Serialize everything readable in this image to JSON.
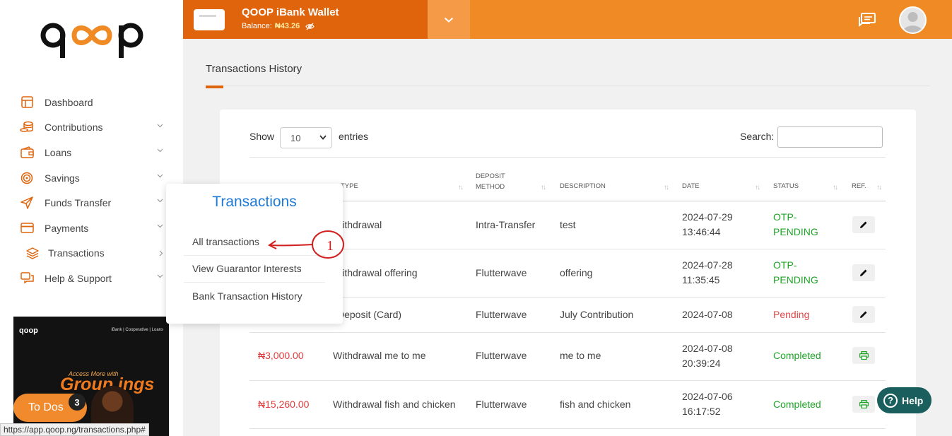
{
  "sidebar": {
    "items": [
      {
        "label": "Dashboard",
        "icon": "layout-icon",
        "has_chevron": false
      },
      {
        "label": "Contributions",
        "icon": "coins-icon",
        "has_chevron": true
      },
      {
        "label": "Loans",
        "icon": "wallet-icon",
        "has_chevron": true
      },
      {
        "label": "Savings",
        "icon": "target-icon",
        "has_chevron": true
      },
      {
        "label": "Funds Transfer",
        "icon": "send-icon",
        "has_chevron": true
      },
      {
        "label": "Payments",
        "icon": "credit-card-icon",
        "has_chevron": true
      },
      {
        "label": "Transactions",
        "icon": "layers-icon",
        "has_chevron": true
      },
      {
        "label": "Help & Support",
        "icon": "chat-bubbles-icon",
        "has_chevron": true
      }
    ],
    "promo": {
      "logo": "qoop",
      "tagline": "iBank | Cooperative | Loans",
      "line": "Access More with",
      "headline": "Group ings"
    },
    "todos": {
      "label": "To Dos",
      "count": "3"
    }
  },
  "topbar": {
    "wallet_title": "QOOP iBank Wallet",
    "balance_label": "Balance:",
    "balance_value": "₦43.26"
  },
  "page": {
    "title": "Transactions History"
  },
  "table_controls": {
    "show_label": "Show",
    "page_size": "10",
    "entries_label": "entries",
    "search_label": "Search:"
  },
  "table": {
    "headers": {
      "type": "TYPE",
      "method_1": "DEPOSIT",
      "method_2": "METHOD",
      "description": "DESCRIPTION",
      "date": "DATE",
      "status": "STATUS",
      "ref": "REF."
    },
    "rows": [
      {
        "amount": "",
        "type": "Withdrawal",
        "method": "Intra-Transfer",
        "description": "test",
        "date": "2024-07-29",
        "time": "13:46:44",
        "status_1": "OTP-",
        "status_2": "PENDING",
        "status_kind": "green",
        "ref_icon": "pencil-icon"
      },
      {
        "amount": "",
        "type": "Withdrawal offering",
        "method": "Flutterwave",
        "description": "offering",
        "date": "2024-07-28",
        "time": "11:35:45",
        "status_1": "OTP-",
        "status_2": "PENDING",
        "status_kind": "green",
        "ref_icon": "pencil-icon"
      },
      {
        "amount": "",
        "type": "Deposit (Card)",
        "method": "Flutterwave",
        "description": "July Contribution",
        "date": "2024-07-08",
        "time": "",
        "status_1": "Pending",
        "status_2": "",
        "status_kind": "red",
        "ref_icon": "pencil-icon"
      },
      {
        "amount": "₦3,000.00",
        "type": "Withdrawal me to me",
        "method": "Flutterwave",
        "description": "me to me",
        "date": "2024-07-08",
        "time": "20:39:24",
        "status_1": "Completed",
        "status_2": "",
        "status_kind": "green",
        "ref_icon": "printer-icon"
      },
      {
        "amount": "₦15,260.00",
        "type": "Withdrawal fish and chicken",
        "method": "Flutterwave",
        "description": "fish and chicken",
        "date": "2024-07-06",
        "time": "16:17:52",
        "status_1": "Completed",
        "status_2": "",
        "status_kind": "green",
        "ref_icon": "printer-icon"
      }
    ]
  },
  "popup": {
    "title": "Transactions",
    "items": [
      "All transactions",
      "View Guarantor Interests",
      "Bank Transaction History"
    ],
    "annotation": "1"
  },
  "help": {
    "label": "Help"
  },
  "status_url": "https://app.qoop.ng/transactions.php#",
  "colors": {
    "brand_orange": "#f08a24",
    "brand_dark_orange": "#e0640c",
    "completed_green": "#1ea327",
    "pending_red": "#e04848",
    "amount_red": "#e03b3b",
    "popup_blue": "#1e7bd6",
    "help_teal": "#1a5e5d"
  }
}
